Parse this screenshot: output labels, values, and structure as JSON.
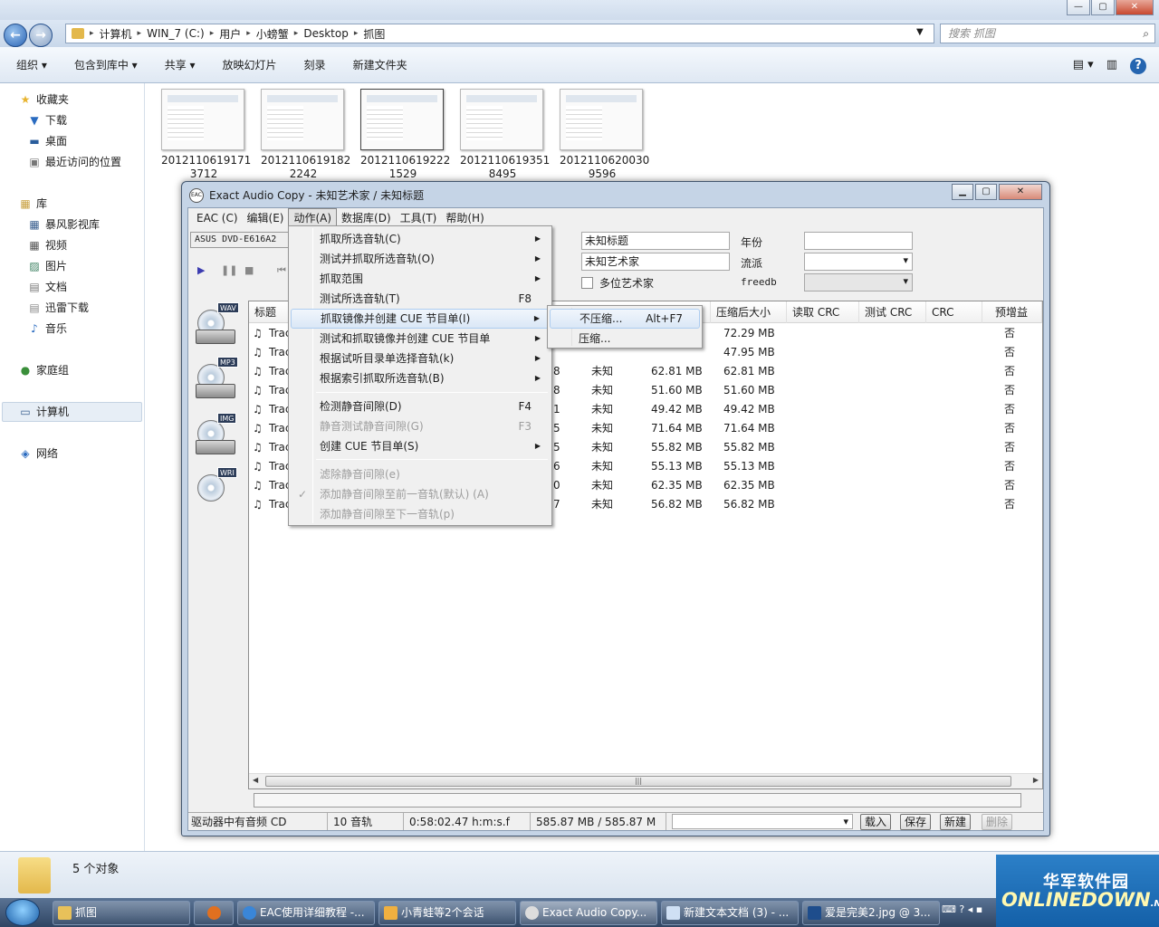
{
  "explorer": {
    "breadcrumb": [
      "计算机",
      "WIN_7 (C:)",
      "用户",
      "小螃蟹",
      "Desktop",
      "抓图"
    ],
    "search_placeholder": "搜索 抓图",
    "toolbar": [
      "组织 ▾",
      "包含到库中 ▾",
      "共享 ▾",
      "放映幻灯片",
      "刻录",
      "新建文件夹"
    ],
    "nav": {
      "favorites": "收藏夹",
      "favorites_items": [
        "下载",
        "桌面",
        "最近访问的位置"
      ],
      "libraries": "库",
      "library_items": [
        "暴风影视库",
        "视频",
        "图片",
        "文档",
        "迅雷下载",
        "音乐"
      ],
      "homegroup": "家庭组",
      "computer": "计算机",
      "network": "网络"
    },
    "files": [
      {
        "line1": "2012110619171",
        "line2": "3712"
      },
      {
        "line1": "2012110619182",
        "line2": "2242"
      },
      {
        "line1": "2012110619222",
        "line2": "1529"
      },
      {
        "line1": "2012110619351",
        "line2": "8495"
      },
      {
        "line1": "2012110620030",
        "line2": "9596"
      }
    ],
    "status": "5 个对象"
  },
  "eac": {
    "title": "Exact Audio Copy   -   未知艺术家 / 未知标题",
    "logo": "EAC",
    "menubar": [
      "EAC (C)",
      "编辑(E)",
      "动作(A)",
      "数据库(D)",
      "工具(T)",
      "帮助(H)"
    ],
    "drive": "ASUS    DVD-E616A2",
    "album_title": "未知标题",
    "album_artist": "未知艺术家",
    "labels": {
      "year": "年份",
      "genre": "流派",
      "multi_artist": "多位艺术家",
      "freedb": "freedb"
    },
    "side_tags": [
      "WAV",
      "MP3",
      "IMG",
      "WRI"
    ],
    "columns": [
      "标题",
      "压缩后大小",
      "读取 CRC",
      "测试 CRC",
      "CRC",
      "预增益"
    ],
    "tracks": [
      {
        "title": "Trac",
        "num": "",
        "status": "",
        "size": "",
        "csize": "72.29 MB",
        "pre": "否"
      },
      {
        "title": "Trac",
        "num": "",
        "status": "",
        "size": "",
        "csize": "47.95 MB",
        "pre": "否"
      },
      {
        "title": "Trac",
        "num": "8",
        "status": "未知",
        "size": "62.81 MB",
        "csize": "62.81 MB",
        "pre": "否"
      },
      {
        "title": "Trac",
        "num": "8",
        "status": "未知",
        "size": "51.60 MB",
        "csize": "51.60 MB",
        "pre": "否"
      },
      {
        "title": "Trac",
        "num": "1",
        "status": "未知",
        "size": "49.42 MB",
        "csize": "49.42 MB",
        "pre": "否"
      },
      {
        "title": "Trac",
        "num": "5",
        "status": "未知",
        "size": "71.64 MB",
        "csize": "71.64 MB",
        "pre": "否"
      },
      {
        "title": "Trac",
        "num": "5",
        "status": "未知",
        "size": "55.82 MB",
        "csize": "55.82 MB",
        "pre": "否"
      },
      {
        "title": "Trac",
        "num": "6",
        "status": "未知",
        "size": "55.13 MB",
        "csize": "55.13 MB",
        "pre": "否"
      },
      {
        "title": "Trac",
        "num": "0",
        "status": "未知",
        "size": "62.35 MB",
        "csize": "62.35 MB",
        "pre": "否"
      },
      {
        "title": "Trac",
        "num": "7",
        "status": "未知",
        "size": "56.82 MB",
        "csize": "56.82 MB",
        "pre": "否"
      }
    ],
    "status": {
      "cd": "驱动器中有音频 CD",
      "tracks": "10 音轨",
      "time": "0:58:02.47 h:m:s.f",
      "size": "585.87 MB / 585.87 M"
    },
    "buttons": {
      "load": "载入",
      "save": "保存",
      "new": "新建",
      "delete": "删除"
    }
  },
  "action_menu": [
    {
      "label": "抓取所选音轨(C)",
      "shortcut": "",
      "arrow": true,
      "disabled": false
    },
    {
      "label": "测试并抓取所选音轨(O)",
      "shortcut": "",
      "arrow": true,
      "disabled": false
    },
    {
      "label": "抓取范围",
      "shortcut": "",
      "arrow": true,
      "disabled": false
    },
    {
      "label": "测试所选音轨(T)",
      "shortcut": "F8",
      "arrow": false,
      "disabled": false
    },
    {
      "label": "抓取镜像并创建 CUE 节目单(I)",
      "shortcut": "",
      "arrow": true,
      "disabled": false
    },
    {
      "label": "测试和抓取镜像并创建 CUE 节目单",
      "shortcut": "",
      "arrow": true,
      "disabled": false
    },
    {
      "label": "根据试听目录单选择音轨(k)",
      "shortcut": "",
      "arrow": true,
      "disabled": false
    },
    {
      "label": "根据索引抓取所选音轨(B)",
      "shortcut": "",
      "arrow": true,
      "disabled": false
    },
    {
      "label": "检测静音间隙(D)",
      "shortcut": "F4",
      "arrow": false,
      "disabled": false
    },
    {
      "label": "静音测试静音间隙(G)",
      "shortcut": "F3",
      "arrow": false,
      "disabled": true
    },
    {
      "label": "创建 CUE 节目单(S)",
      "shortcut": "",
      "arrow": true,
      "disabled": false
    },
    {
      "label": "滤除静音间隙(e)",
      "shortcut": "",
      "arrow": false,
      "disabled": true
    },
    {
      "label": "添加静音间隙至前一音轨(默认) (A)",
      "shortcut": "",
      "arrow": false,
      "disabled": true
    },
    {
      "label": "添加静音间隙至下一音轨(p)",
      "shortcut": "",
      "arrow": false,
      "disabled": true
    }
  ],
  "submenu": [
    {
      "label": "不压缩...",
      "shortcut": "Alt+F7"
    },
    {
      "label": "压缩...",
      "shortcut": ""
    }
  ],
  "taskbar": [
    {
      "label": "抓图",
      "color": "#e8c15a"
    },
    {
      "label": "EAC使用详细教程 -...",
      "color": "#3a86d8"
    },
    {
      "label": "小青蛙等2个会话",
      "color": "#f0b040"
    },
    {
      "label": "Exact Audio Copy...",
      "color": "#dddddd"
    },
    {
      "label": "新建文本文档 (3) - ...",
      "color": "#cfe0f4"
    },
    {
      "label": "爱是完美2.jpg @ 3...",
      "color": "#1e4d8c"
    }
  ],
  "watermark": {
    "cn": "华军软件园",
    "en": "ONLINEDOWN",
    "en_suffix": ".NET"
  }
}
